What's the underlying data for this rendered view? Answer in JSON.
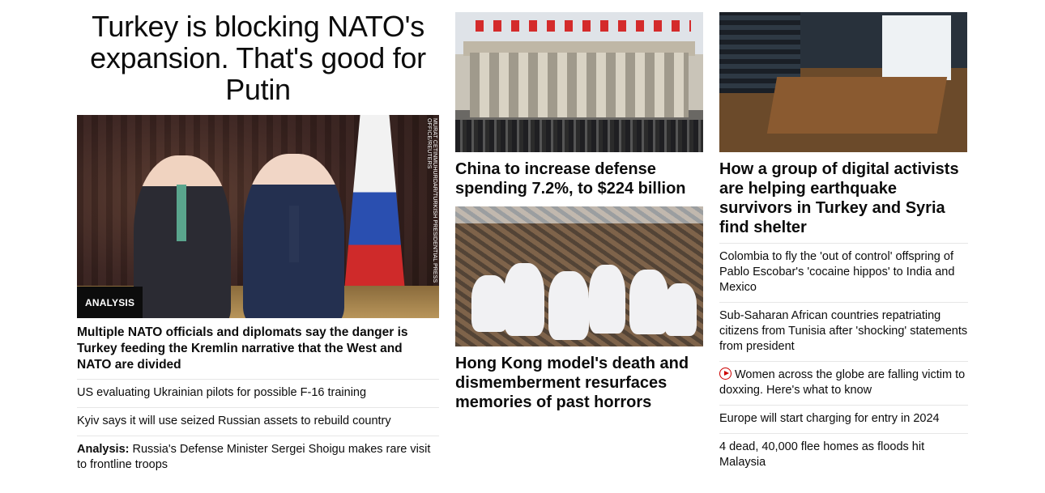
{
  "main": {
    "headline": "Turkey is blocking NATO's expansion. That's good for Putin",
    "badge": "ANALYSIS",
    "credit": "MURAT CETINMUHURDAR/TURKISH PRESIDENTIAL PRESS OFFICE/REUTERS",
    "subhead": "Multiple NATO officials and diplomats say the danger is Turkey feeding the Kremlin narrative that the West and NATO are divided",
    "links": [
      {
        "prefix": "",
        "text": "US evaluating Ukrainian pilots for possible F-16 training"
      },
      {
        "prefix": "",
        "text": "Kyiv says it will use seized Russian assets to rebuild country"
      },
      {
        "prefix": "Analysis:",
        "text": " Russia's Defense Minister Sergei Shoigu makes rare visit to frontline troops"
      }
    ]
  },
  "middle": {
    "story1": {
      "title": "China to increase defense spending 7.2%, to $224 billion"
    },
    "story2": {
      "title": "Hong Kong model's death and dismemberment resurfaces memories of past horrors"
    }
  },
  "right": {
    "story1": {
      "title": "How a group of digital activists are helping earthquake survivors in Turkey and Syria find shelter"
    },
    "links": [
      {
        "video": false,
        "text": "Colombia to fly the 'out of control' offspring of Pablo Escobar's 'cocaine hippos' to India and Mexico"
      },
      {
        "video": false,
        "text": "Sub-Saharan African countries repatriating citizens from Tunisia after 'shocking' statements from president"
      },
      {
        "video": true,
        "text": "Women across the globe are falling victim to doxxing. Here's what to know"
      },
      {
        "video": false,
        "text": "Europe will start charging for entry in 2024"
      },
      {
        "video": false,
        "text": "4 dead, 40,000 flee homes as floods hit Malaysia"
      }
    ]
  }
}
